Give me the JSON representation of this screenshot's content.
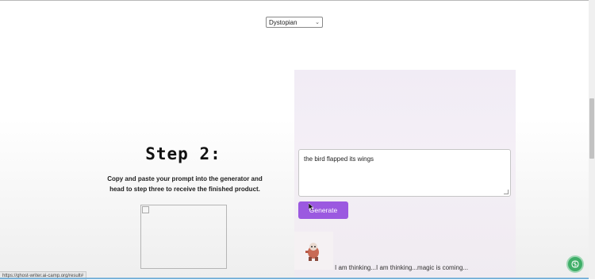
{
  "genre_select": {
    "selected": "Dystopian"
  },
  "step": {
    "title": "Step 2:",
    "description": "Copy and paste your prompt into the generator and head to step three to receive the finished product."
  },
  "generator": {
    "prompt_value": "the bird flapped its wings",
    "generate_label": "Generate",
    "thinking_text": "I am thinking...I am thinking...magic is coming..."
  },
  "status_bar": {
    "url": "https://ghost-writer.ai-camp.org/result#"
  },
  "colors": {
    "accent_button": "#9b59e0",
    "panel_bg": "#f1ecf5",
    "brain_button": "#3fae68"
  },
  "icons": [
    "chevron-down-icon",
    "broken-image-icon",
    "cursor-icon",
    "robot-icon",
    "brain-icon"
  ]
}
